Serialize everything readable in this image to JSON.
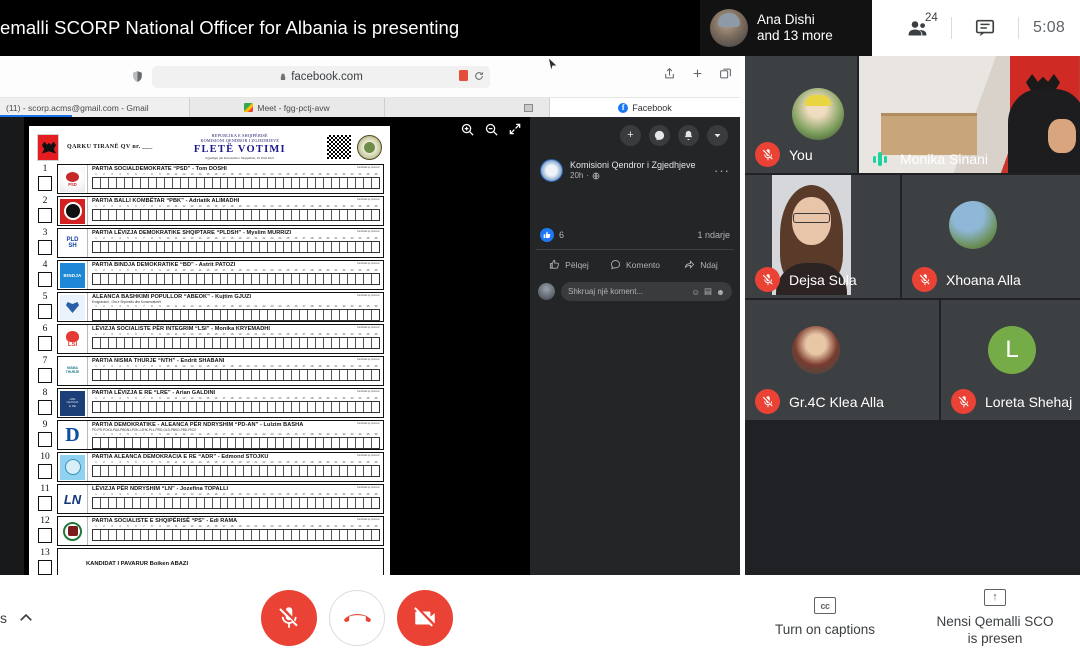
{
  "presenter_banner": {
    "text": "emalli SCORP National Officer for Albania is presenting"
  },
  "meeting_header": {
    "speaker_name": "Ana Dishi",
    "speaker_more": "and 13 more",
    "participants_count": "24",
    "participants_icon": "people-icon",
    "chat_icon": "chat-icon",
    "clock": "5:08"
  },
  "browser": {
    "shield_icon": "shield-icon",
    "lock_icon": "lock-icon",
    "url": "facebook.com",
    "reload_icon": "reload-icon",
    "share_icon": "share-icon",
    "new_tab_icon": "plus-icon",
    "tabs_icon": "tabs-icon",
    "tabs": [
      {
        "label": "(11) - scorp.acms@gmail.com - Gmail",
        "icon": "none"
      },
      {
        "label": "Meet - fgg-pctj-avw",
        "icon": "meet-icon"
      },
      {
        "label": "",
        "icon": "window-icon"
      },
      {
        "label": "Facebook",
        "icon": "facebook-icon"
      }
    ]
  },
  "doc_toolbar": {
    "zoom_in_icon": "zoom-in-icon",
    "zoom_out_icon": "zoom-out-icon",
    "expand_icon": "expand-icon"
  },
  "ballot": {
    "district": "QARKU TIRANË   QV nr. ___",
    "republic": "REPUBLIKA E SHQIPËRISË",
    "commission": "KOMISIONI QENDROR I ZGJEDHJEVE",
    "title": "FLETË VOTIMI",
    "subtitle": "Zgjedhjet për Kuvendin e Shqipërisë, 25 Prill 2021",
    "qr_icon": "qr-code-icon",
    "seal_icon": "state-seal-icon",
    "cell_note": "Kandidati që preferon",
    "parties": [
      {
        "num": "1",
        "logo": "psd-logo",
        "name": "PARTIA SOCIALDEMOKRATE “PSD” - Tom DOSHI",
        "sub": ""
      },
      {
        "num": "2",
        "logo": "pbk-logo",
        "name": "PARTIA BALLI KOMBËTAR “PBK” - Adriatik ALIMADHI",
        "sub": ""
      },
      {
        "num": "3",
        "logo": "pldsh-logo",
        "name": "PARTIA LËVIZJA DEMOKRATIKE SHQIPTARE “PLDSH” - Myslim MURRIZI",
        "sub": ""
      },
      {
        "num": "4",
        "logo": "bd-logo",
        "name": "PARTIA BINDJA DEMOKRATIKE “BD” - Astrit PATOZI",
        "sub": ""
      },
      {
        "num": "5",
        "logo": "abeok-logo",
        "name": "ALEANCA BASHKIMI POPULLOR “ABEOK” - Kujtim GJUZI",
        "sub": "Emigracioni - Gra e Shpresës dhe Konservatorët"
      },
      {
        "num": "6",
        "logo": "lsi-logo",
        "name": "LËVIZJA SOCIALISTE PËR INTEGRIM “LSI” - Monika KRYEMADHI",
        "sub": ""
      },
      {
        "num": "7",
        "logo": "nth-logo",
        "name": "PARTIA NISMA THURJE “NTH” - Endrit SHABANI",
        "sub": ""
      },
      {
        "num": "8",
        "logo": "lre-logo",
        "name": "PARTIA LËVIZJA E RE “LRE” - Arian GALDINI",
        "sub": ""
      },
      {
        "num": "9",
        "logo": "pdan-logo",
        "name": "PARTIA DEMOKRATIKE - ALEANCA PËR NDRYSHIM “PD-AN” - Lulzim BASHA",
        "sub": "PD-PR-POKU-PAA-PBDNJ-POK-LZHK-PLL-PRD-GLD-PBKD-PBD-PKDI"
      },
      {
        "num": "10",
        "logo": "adr-logo",
        "name": "PARTIA ALEANCA DEMOKRACIA E RE “ADR” - Edmond STOJKU",
        "sub": ""
      },
      {
        "num": "11",
        "logo": "ln-logo",
        "name": "LËVIZJA PËR NDRYSHIM “LN” - Jozefina TOPALLI",
        "sub": ""
      },
      {
        "num": "12",
        "logo": "ps-logo",
        "name": "PARTIA SOCIALISTE E SHQIPËRISË “PS” - Edi RAMA",
        "sub": ""
      }
    ],
    "independent": {
      "num": "13",
      "label": "KANDIDAT I PAVARUR    Boiken ABAZI"
    }
  },
  "facebook": {
    "top_actions": [
      {
        "icon": "plus-icon",
        "glyph": "+"
      },
      {
        "icon": "messenger-icon",
        "glyph": "●"
      },
      {
        "icon": "bell-icon",
        "glyph": "●"
      },
      {
        "icon": "chevron-down-icon",
        "glyph": "▼"
      }
    ],
    "post": {
      "page_name": "Komisioni Qendror i Zgjedhjeve",
      "time": "20h",
      "privacy_icon": "globe-icon",
      "more_icon": "more-options-icon",
      "reaction_count": "6",
      "shares": "1 ndarje",
      "actions": [
        {
          "label": "Pëlqej",
          "icon": "thumbs-up-icon"
        },
        {
          "label": "Komento",
          "icon": "comment-icon"
        },
        {
          "label": "Ndaj",
          "icon": "share-arrow-icon"
        }
      ],
      "comment_placeholder": "Shkruaj një koment...",
      "comment_icons": [
        "emoji-icon",
        "gif-icon",
        "sticker-icon"
      ]
    }
  },
  "tiles": [
    {
      "name": "You",
      "mic": "muted",
      "media": "avatar"
    },
    {
      "name": "Monika Sinani",
      "mic": "speaking",
      "media": "camera"
    },
    {
      "name": "Dejsa Sula",
      "mic": "muted",
      "media": "camera"
    },
    {
      "name": "Xhoana Alla",
      "mic": "muted",
      "media": "avatar"
    },
    {
      "name": "Gr.4C Klea Alla",
      "mic": "muted",
      "media": "avatar"
    },
    {
      "name": "Loreta Shehaj",
      "mic": "muted",
      "media": "initial",
      "initial": "L"
    }
  ],
  "bottom_bar": {
    "meeting_details_text": "s",
    "expand_icon": "chevron-up-icon",
    "mic_button": {
      "icon": "mic-off-icon",
      "state": "muted"
    },
    "hangup_button": {
      "icon": "end-call-icon"
    },
    "camera_button": {
      "icon": "camera-off-icon",
      "state": "off"
    },
    "captions": {
      "label": "Turn on captions",
      "icon": "closed-captions-icon"
    },
    "present": {
      "label": "Nensi Qemalli SCO",
      "label2": "is presen",
      "icon": "present-screen-icon"
    }
  },
  "colors": {
    "google_red": "#ea4335",
    "google_blue": "#1a73e8",
    "meet_bg": "#202124",
    "fb_dark": "#242526",
    "fb_blue": "#1877f2",
    "audio_green": "#1cd4a0",
    "avatar_green": "#76ac47"
  }
}
